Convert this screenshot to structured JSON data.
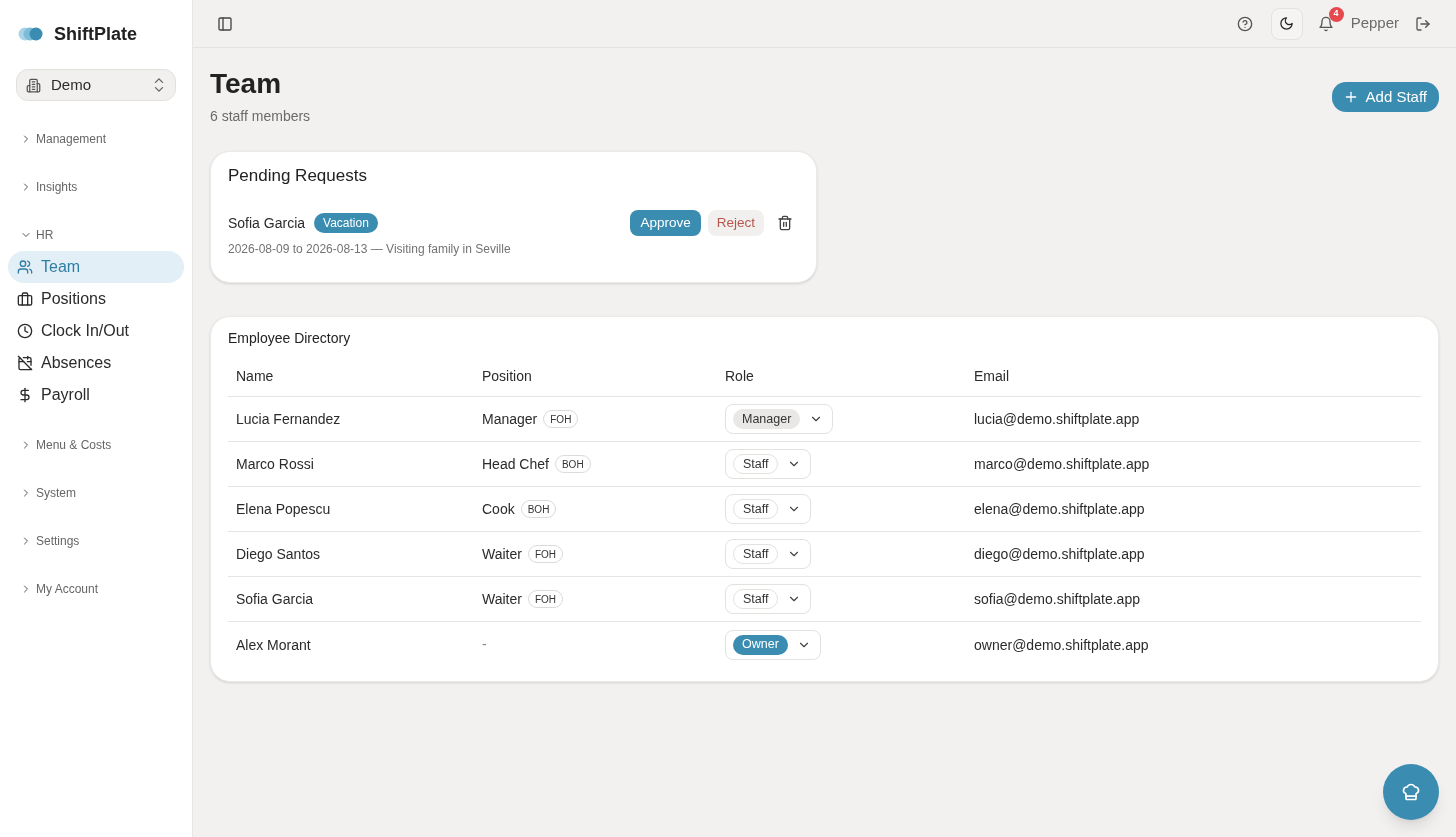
{
  "sidebar": {
    "brand": "ShiftPlate",
    "workspace": "Demo",
    "groups": [
      {
        "label": "Management",
        "expanded": false
      },
      {
        "label": "Insights",
        "expanded": false
      },
      {
        "label": "HR",
        "expanded": true,
        "items": [
          {
            "label": "Team",
            "selected": true
          },
          {
            "label": "Positions",
            "selected": false
          },
          {
            "label": "Clock In/Out",
            "selected": false
          },
          {
            "label": "Absences",
            "selected": false
          },
          {
            "label": "Payroll",
            "selected": false
          }
        ]
      },
      {
        "label": "Menu & Costs",
        "expanded": false
      },
      {
        "label": "System",
        "expanded": false
      },
      {
        "label": "Settings",
        "expanded": false
      },
      {
        "label": "My Account",
        "expanded": false
      }
    ]
  },
  "topbar": {
    "notification_count": "4",
    "user": "Pepper"
  },
  "header": {
    "title": "Team",
    "subtitle": "6 staff members",
    "add_button": "Add Staff"
  },
  "pending_requests": {
    "title": "Pending Requests",
    "requests": [
      {
        "name": "Sofia Garcia",
        "type": "Vacation",
        "details": "2026-08-09 to 2026-08-13 — Visiting family in Seville",
        "approve": "Approve",
        "reject": "Reject"
      }
    ]
  },
  "directory": {
    "title": "Employee Directory",
    "columns": [
      "Name",
      "Position",
      "Role",
      "Email"
    ],
    "rows": [
      {
        "name": "Lucia Fernandez",
        "position": "Manager",
        "area": "FOH",
        "role": {
          "label": "Manager",
          "kind": "manager"
        },
        "email": "lucia@demo.shiftplate.app"
      },
      {
        "name": "Marco Rossi",
        "position": "Head Chef",
        "area": "BOH",
        "role": {
          "label": "Staff",
          "kind": "staff"
        },
        "email": "marco@demo.shiftplate.app"
      },
      {
        "name": "Elena Popescu",
        "position": "Cook",
        "area": "BOH",
        "role": {
          "label": "Staff",
          "kind": "staff"
        },
        "email": "elena@demo.shiftplate.app"
      },
      {
        "name": "Diego Santos",
        "position": "Waiter",
        "area": "FOH",
        "role": {
          "label": "Staff",
          "kind": "staff"
        },
        "email": "diego@demo.shiftplate.app"
      },
      {
        "name": "Sofia Garcia",
        "position": "Waiter",
        "area": "FOH",
        "role": {
          "label": "Staff",
          "kind": "staff"
        },
        "email": "sofia@demo.shiftplate.app"
      },
      {
        "name": "Alex Morant",
        "position": "-",
        "role": {
          "label": "Owner",
          "kind": "owner"
        },
        "email": "owner@demo.shiftplate.app"
      }
    ]
  }
}
